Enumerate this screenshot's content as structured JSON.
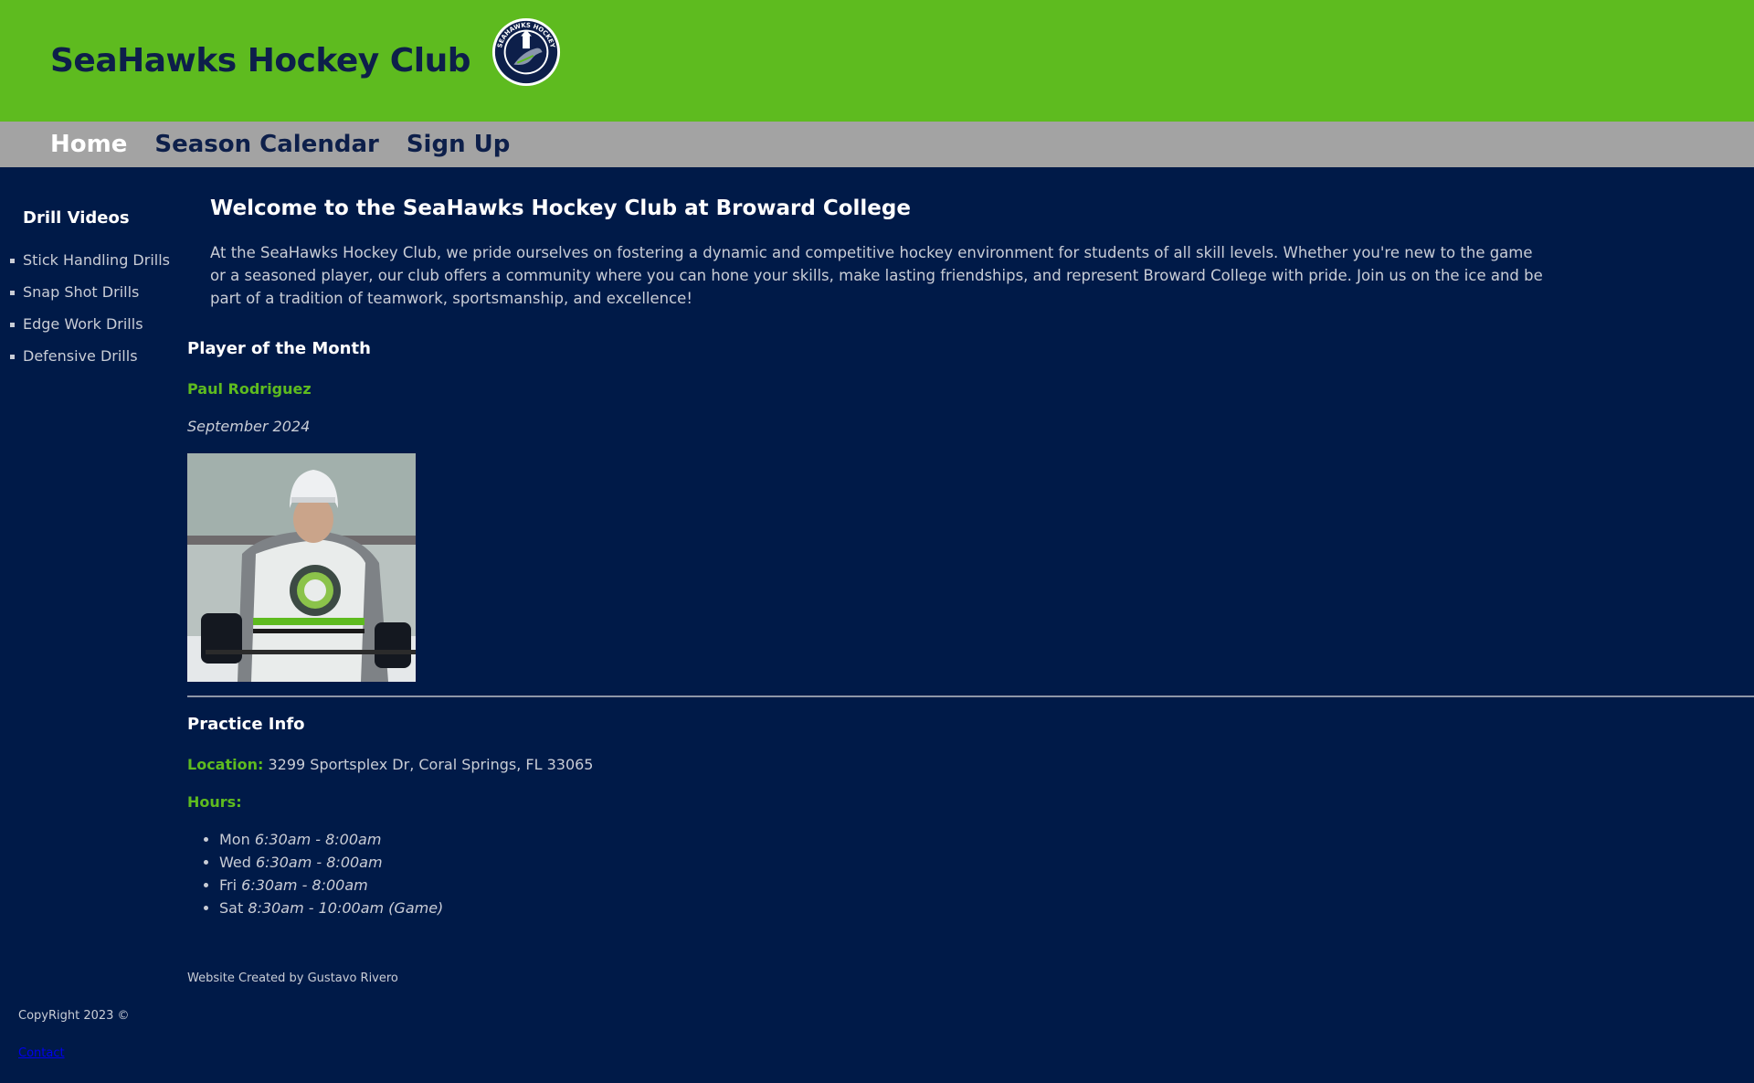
{
  "header": {
    "title": "SeaHawks Hockey Club",
    "logo_text": "SEAHAWKS HOCKEY"
  },
  "nav": {
    "items": [
      {
        "label": "Home",
        "active": true
      },
      {
        "label": "Season Calendar",
        "active": false
      },
      {
        "label": "Sign Up",
        "active": false
      }
    ]
  },
  "sidebar": {
    "title": "Drill Videos",
    "items": [
      {
        "label": "Stick Handling Drills"
      },
      {
        "label": "Snap Shot Drills"
      },
      {
        "label": "Edge Work Drills"
      },
      {
        "label": "Defensive Drills"
      }
    ]
  },
  "main": {
    "welcome_title": "Welcome to the SeaHawks Hockey Club at Broward College",
    "welcome_text": "At the SeaHawks Hockey Club, we pride ourselves on fostering a dynamic and competitive hockey environment for students of all skill levels. Whether you're new to the game or a seasoned player, our club offers a community where you can hone your skills, make lasting friendships, and represent Broward College with pride. Join us on the ice and be part of a tradition of teamwork, sportsmanship, and excellence!",
    "player_of_month": {
      "heading": "Player of the Month",
      "name": "Paul Rodriguez",
      "date": "September 2024"
    },
    "practice": {
      "heading": "Practice Info",
      "location_label": "Location:",
      "location": "3299 Sportsplex Dr, Coral Springs, FL 33065",
      "hours_label": "Hours:",
      "hours": [
        {
          "day": "Mon",
          "time": "6:30am - 8:00am"
        },
        {
          "day": "Wed",
          "time": "6:30am - 8:00am"
        },
        {
          "day": "Fri",
          "time": "6:30am - 8:00am"
        },
        {
          "day": "Sat",
          "time": "8:30am - 10:00am (Game)"
        }
      ]
    },
    "credit": "Website Created by Gustavo Rivero"
  },
  "footer": {
    "copyright": "CopyRight 2023 ©",
    "contact_label": "Contact"
  },
  "colors": {
    "header_green": "#5ebb1f",
    "nav_gray": "#a3a3a3",
    "page_navy": "#001a48",
    "title_navy": "#0d1f4a",
    "accent_green": "#5ebb1f"
  }
}
